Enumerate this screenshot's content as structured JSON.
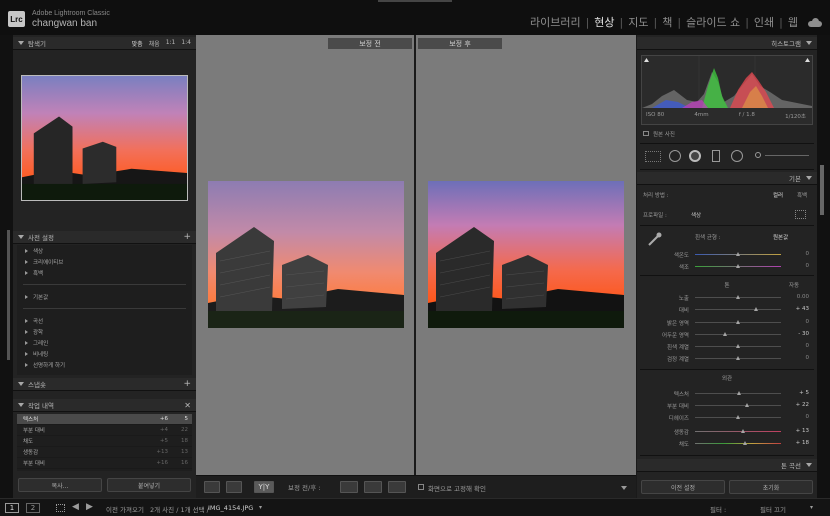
{
  "app": {
    "logo": "Lrc",
    "name": "Adobe Lightroom Classic",
    "user": "changwan ban"
  },
  "modules": [
    {
      "label": "라이브러리",
      "active": false
    },
    {
      "label": "현상",
      "active": true
    },
    {
      "label": "지도",
      "active": false
    },
    {
      "label": "책",
      "active": false
    },
    {
      "label": "슬라이드 쇼",
      "active": false
    },
    {
      "label": "인쇄",
      "active": false
    },
    {
      "label": "웹",
      "active": false
    }
  ],
  "navigator": {
    "title": "탐색기",
    "opts": [
      "맞춤",
      "채움",
      "1:1",
      "1:4"
    ]
  },
  "presets": {
    "title": "사전 설정",
    "group1": [
      "색상",
      "크리에이티브",
      "흑백"
    ],
    "group2": [
      "기본값"
    ],
    "group3": [
      "곡선",
      "광학",
      "그레인",
      "비네팅",
      "선명하게 하기"
    ]
  },
  "snapshots": {
    "title": "스냅숏"
  },
  "history": {
    "title": "작업 내역",
    "rows": [
      {
        "name": "텍스처",
        "v1": "+6",
        "v2": "5"
      },
      {
        "name": "부분 대비",
        "v1": "+4",
        "v2": "22"
      },
      {
        "name": "채도",
        "v1": "+5",
        "v2": "18"
      },
      {
        "name": "생동감",
        "v1": "+13",
        "v2": "13"
      },
      {
        "name": "부분 대비",
        "v1": "+16",
        "v2": "16"
      }
    ]
  },
  "left_buttons": {
    "copy": "복사...",
    "paste": "붙여넣기"
  },
  "compare": {
    "before": "보정 전",
    "after": "보정 후"
  },
  "toolbar": {
    "yy": "Y|Y",
    "label": "보정 전/후 :",
    "zoom_check": "화면으로 고정해 확인"
  },
  "histogram": {
    "title": "히스토그램",
    "iso": "ISO 80",
    "focal": "4mm",
    "fstop": "f / 1.8",
    "shutter": "1/120초",
    "original": "원본 사진"
  },
  "basic": {
    "title": "기본",
    "treatment_label": "처리 방법 :",
    "color": "컬러",
    "bw": "흑백",
    "profile_label": "프로파일 :",
    "profile_value": "색상",
    "wb_label": "흰색 균형 :",
    "wb_value": "원본값",
    "temp": {
      "label": "색온도",
      "value": "0",
      "pos": 0.5
    },
    "tint": {
      "label": "색조",
      "value": "0",
      "pos": 0.5
    },
    "tone_title": "톤",
    "auto": "자동",
    "tone": [
      {
        "label": "노출",
        "value": "0.00",
        "pos": 0.5,
        "dim": true
      },
      {
        "label": "대비",
        "value": "+ 43",
        "pos": 0.72,
        "dim": false
      }
    ],
    "tone2": [
      {
        "label": "밝은 영역",
        "value": "0",
        "pos": 0.5,
        "dim": true
      },
      {
        "label": "어두운 영역",
        "value": "- 30",
        "pos": 0.35,
        "dim": false
      },
      {
        "label": "흰색 계열",
        "value": "0",
        "pos": 0.5,
        "dim": true
      },
      {
        "label": "검정 계열",
        "value": "0",
        "pos": 0.5,
        "dim": true
      }
    ],
    "presence_title": "외관",
    "presence": [
      {
        "label": "텍스처",
        "value": "+ 5",
        "pos": 0.52,
        "dim": false
      },
      {
        "label": "부분 대비",
        "value": "+ 22",
        "pos": 0.61,
        "dim": false
      },
      {
        "label": "디헤이즈",
        "value": "0",
        "pos": 0.5,
        "dim": true
      }
    ],
    "presence2": [
      {
        "label": "생동감",
        "value": "+ 13",
        "pos": 0.56,
        "dim": false
      },
      {
        "label": "채도",
        "value": "+ 18",
        "pos": 0.59,
        "dim": false
      }
    ]
  },
  "tone_curve": {
    "title": "톤 곡선"
  },
  "right_buttons": {
    "prev": "이전 설정",
    "reset": "초기화"
  },
  "status": {
    "p1": "1",
    "p2": "2",
    "source": "이전 가져오기",
    "count": "2개 사진 / 1개 선택 /",
    "file": "IMG_4154.JPG",
    "filter_label": "필터 :",
    "filter_value": "필터 끄기"
  }
}
